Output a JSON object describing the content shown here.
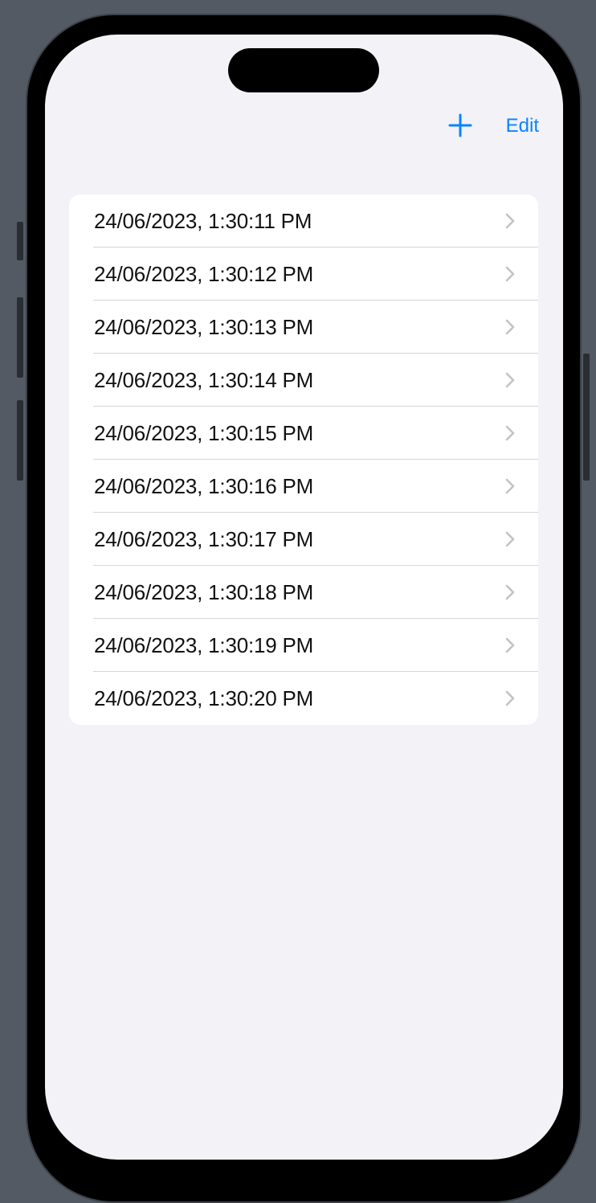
{
  "nav": {
    "add_icon": "plus-icon",
    "edit_label": "Edit",
    "accent_color": "#0a84ff"
  },
  "list": {
    "chevron_icon": "chevron-right-icon",
    "items": [
      {
        "label": "24/06/2023, 1:30:11 PM"
      },
      {
        "label": "24/06/2023, 1:30:12 PM"
      },
      {
        "label": "24/06/2023, 1:30:13 PM"
      },
      {
        "label": "24/06/2023, 1:30:14 PM"
      },
      {
        "label": "24/06/2023, 1:30:15 PM"
      },
      {
        "label": "24/06/2023, 1:30:16 PM"
      },
      {
        "label": "24/06/2023, 1:30:17 PM"
      },
      {
        "label": "24/06/2023, 1:30:18 PM"
      },
      {
        "label": "24/06/2023, 1:30:19 PM"
      },
      {
        "label": "24/06/2023, 1:30:20 PM"
      }
    ]
  }
}
